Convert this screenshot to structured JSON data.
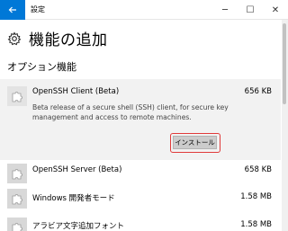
{
  "titlebar": {
    "app_title": "設定",
    "back_icon": "arrow-left-icon",
    "minimize": "─",
    "maximize": "☐",
    "close": "✕"
  },
  "header": {
    "title": "機能の追加",
    "icon": "gear-icon"
  },
  "section": {
    "title": "オプション機能"
  },
  "features": [
    {
      "name": "OpenSSH Client (Beta)",
      "size": "656 KB",
      "description": "Beta release of a secure shell (SSH) client, for secure key management and access to remote machines.",
      "install_label": "インストール",
      "expanded": true
    },
    {
      "name": "OpenSSH Server (Beta)",
      "size": "658 KB"
    },
    {
      "name": "Windows 開発者モード",
      "size": "1.58 MB"
    },
    {
      "name": "アラビア文字追加フォント",
      "size": "1.58 MB"
    }
  ],
  "colors": {
    "accent": "#0078d7",
    "highlight_border": "#e03a3a",
    "expanded_bg": "#f2f2f2"
  }
}
